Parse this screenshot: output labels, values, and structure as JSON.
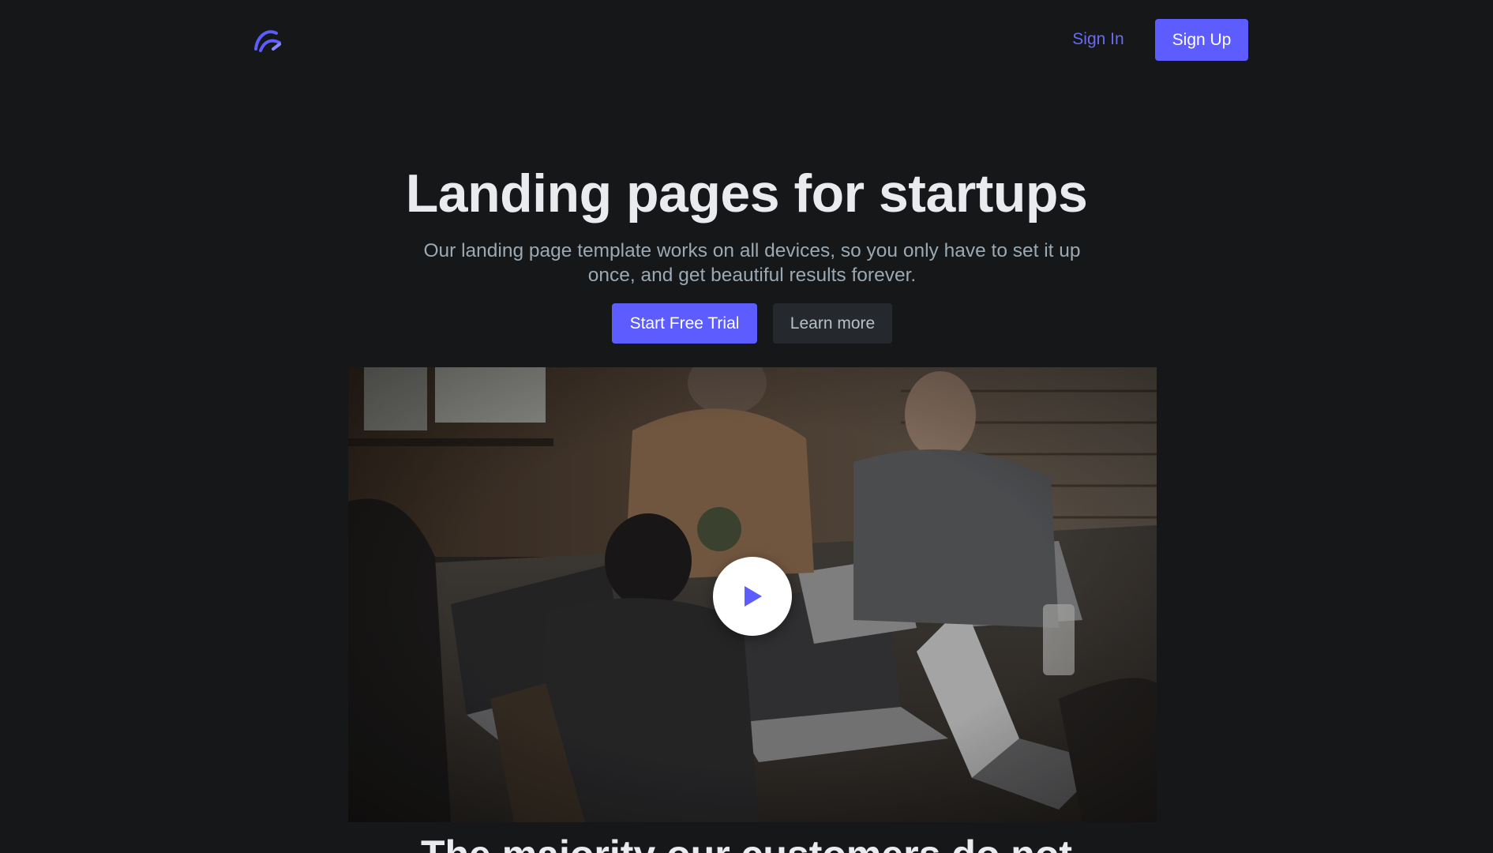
{
  "header": {
    "logo_icon": "brand-logo-icon",
    "sign_in_label": "Sign In",
    "sign_up_label": "Sign Up"
  },
  "hero": {
    "title": "Landing pages for startups",
    "subtitle": "Our landing page template works on all devices, so you only have to set it up once, and get beautiful results forever.",
    "primary_cta": "Start Free Trial",
    "secondary_cta": "Learn more"
  },
  "video": {
    "play_icon": "play-icon"
  },
  "next_section": {
    "heading": "The majority our customers do not"
  },
  "colors": {
    "background": "#151719",
    "accent": "#5d5dff",
    "heading": "#e9ebee",
    "body_text": "#9ca9b3",
    "secondary_button": "#25282c"
  }
}
